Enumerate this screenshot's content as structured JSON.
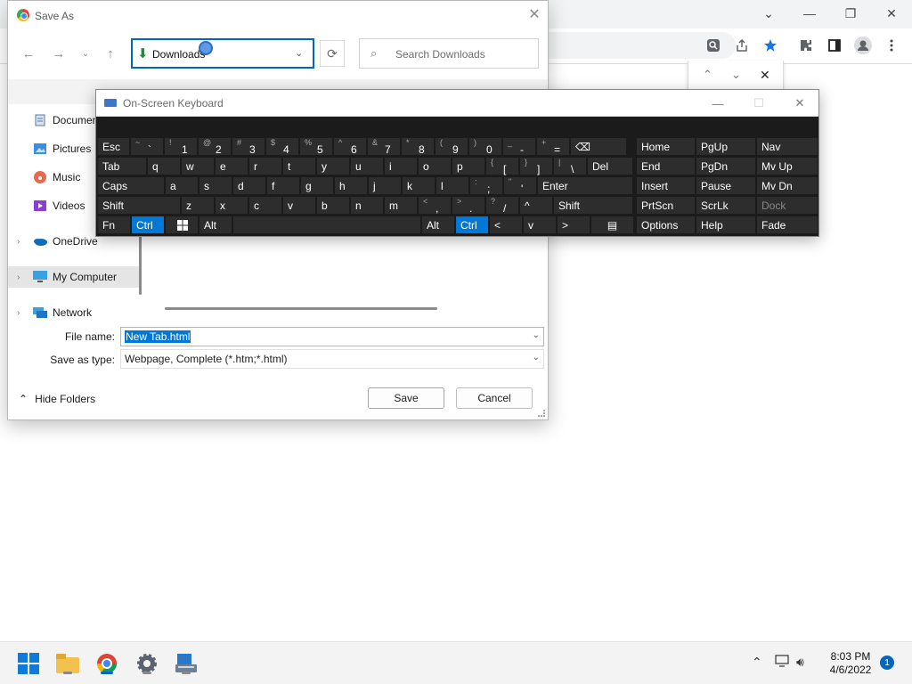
{
  "chrome": {
    "window_controls": {
      "minimize": "—",
      "restore": "❐",
      "close": "✕",
      "tab_search": "⌄"
    },
    "find_bar": {
      "up": "⌃",
      "down": "⌄",
      "close": "✕"
    }
  },
  "save_dialog": {
    "title": "Save As",
    "address": "Downloads",
    "search_placeholder": "Search Downloads",
    "sidebar": [
      {
        "label": "Documents",
        "icon": "documents-icon"
      },
      {
        "label": "Pictures",
        "icon": "pictures-icon"
      },
      {
        "label": "Music",
        "icon": "music-icon"
      },
      {
        "label": "Videos",
        "icon": "videos-icon"
      },
      {
        "label": "OneDrive",
        "icon": "onedrive-icon"
      },
      {
        "label": "My Computer",
        "icon": "computer-icon",
        "selected": true
      },
      {
        "label": "Network",
        "icon": "network-icon"
      }
    ],
    "file_name_label": "File name:",
    "file_name_value": "New Tab.html",
    "save_type_label": "Save as type:",
    "save_type_value": "Webpage, Complete (*.htm;*.html)",
    "hide_folders": "Hide Folders",
    "save_button": "Save",
    "cancel_button": "Cancel"
  },
  "osk": {
    "title": "On-Screen Keyboard",
    "row1": [
      {
        "main": "Esc"
      },
      {
        "sec": "~",
        "pri": "`"
      },
      {
        "sec": "!",
        "pri": "1"
      },
      {
        "sec": "@",
        "pri": "2"
      },
      {
        "sec": "#",
        "pri": "3"
      },
      {
        "sec": "$",
        "pri": "4"
      },
      {
        "sec": "%",
        "pri": "5"
      },
      {
        "sec": "^",
        "pri": "6"
      },
      {
        "sec": "&",
        "pri": "7"
      },
      {
        "sec": "*",
        "pri": "8"
      },
      {
        "sec": "(",
        "pri": "9"
      },
      {
        "sec": ")",
        "pri": "0"
      },
      {
        "sec": "_",
        "pri": "-"
      },
      {
        "sec": "+",
        "pri": "="
      },
      {
        "main": "⌫"
      }
    ],
    "row2_labels": [
      "Tab",
      "q",
      "w",
      "e",
      "r",
      "t",
      "y",
      "u",
      "i",
      "o",
      "p"
    ],
    "row2_extra": [
      {
        "sec": "{",
        "pri": "["
      },
      {
        "sec": "}",
        "pri": "]"
      },
      {
        "sec": "|",
        "pri": "\\"
      },
      {
        "main": "Del"
      }
    ],
    "row3_labels": [
      "Caps",
      "a",
      "s",
      "d",
      "f",
      "g",
      "h",
      "j",
      "k",
      "l"
    ],
    "row3_extra": [
      {
        "sec": ":",
        "pri": ";"
      },
      {
        "sec": "\"",
        "pri": "'"
      },
      {
        "main": "Enter"
      }
    ],
    "row4_labels": [
      "Shift",
      "z",
      "x",
      "c",
      "v",
      "b",
      "n",
      "m"
    ],
    "row4_extra": [
      {
        "sec": "<",
        "pri": ","
      },
      {
        "sec": ">",
        "pri": "."
      },
      {
        "sec": "?",
        "pri": "/"
      },
      {
        "main": "^"
      },
      {
        "main": "Shift"
      }
    ],
    "row5": {
      "fn": "Fn",
      "ctrl": "Ctrl",
      "alt": "Alt",
      "alt_r": "Alt",
      "ctrl_r": "Ctrl",
      "left": "<",
      "down": "v",
      "right": ">",
      "menu": "▤"
    },
    "nav_keys": [
      "Home",
      "PgUp",
      "Nav",
      "End",
      "PgDn",
      "Mv Up",
      "Insert",
      "Pause",
      "Mv Dn",
      "PrtScn",
      "ScrLk",
      "Dock",
      "Options",
      "Help",
      "Fade"
    ],
    "active_color": "#0078d7"
  },
  "taskbar": {
    "time": "8:03 PM",
    "date": "4/6/2022",
    "notifications": "1"
  }
}
